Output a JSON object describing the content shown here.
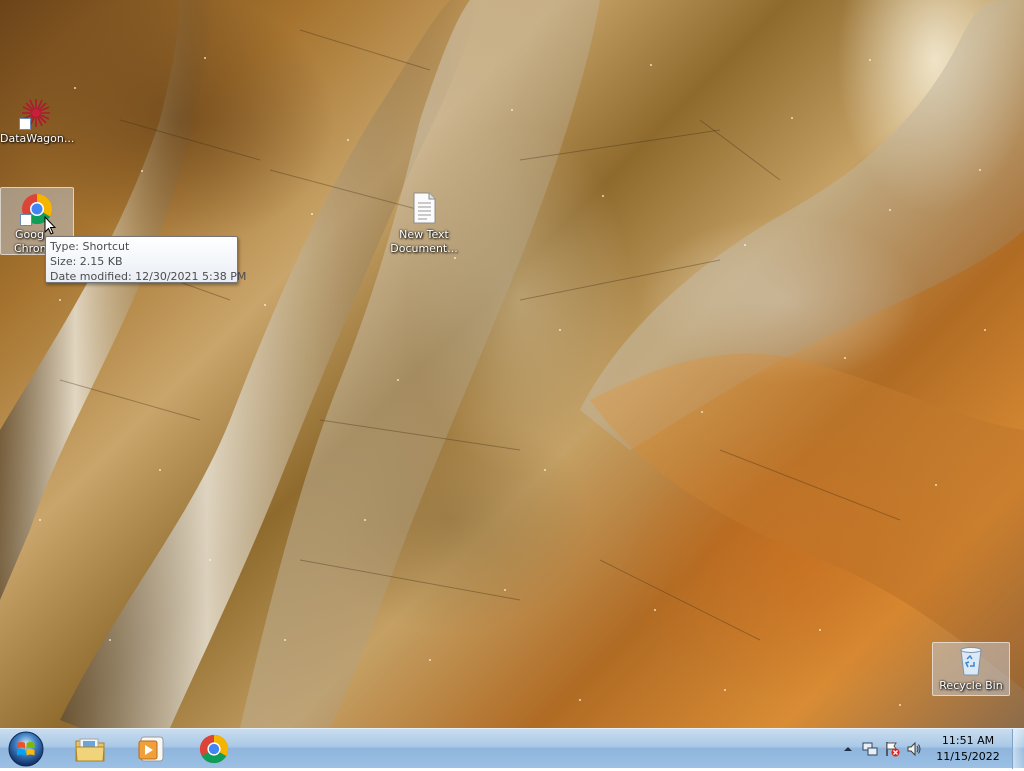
{
  "desktop": {
    "icons": [
      {
        "label": "DataWagon...",
        "icon": "datawagon-app-icon"
      },
      {
        "label": "Google Chrome",
        "label_visible": "Goog",
        "label_visible_2": "Chron",
        "icon": "chrome-icon"
      },
      {
        "label": "New Text Document...",
        "label_line1": "New Text",
        "label_line2": "Document...",
        "icon": "text-document-icon"
      },
      {
        "label": "Recycle Bin",
        "icon": "recycle-bin-icon"
      }
    ]
  },
  "tooltip": {
    "type": "Type: Shortcut",
    "size": "Size: 2.15 KB",
    "modified": "Date modified: 12/30/2021 5:38 PM"
  },
  "taskbar": {
    "start": {
      "icon": "windows-start-orb-icon"
    },
    "pinned": [
      {
        "name": "Windows Explorer",
        "icon": "folder-libraries-icon"
      },
      {
        "name": "Windows Media Player",
        "icon": "media-player-icon"
      },
      {
        "name": "Google Chrome",
        "icon": "chrome-icon"
      }
    ],
    "tray": {
      "icons": [
        "show-hidden-icons-chevron",
        "network-icon",
        "action-center-flag-icon",
        "volume-icon"
      ],
      "time": "11:51 AM",
      "date": "11/15/2022"
    }
  },
  "colors": {
    "taskbar_top": "#c9ddf0",
    "taskbar_bottom": "#9cc0e4",
    "selection": "#c8d7eb",
    "chrome_red": "#db4437",
    "chrome_yellow": "#f4b400",
    "chrome_green": "#0f9d58",
    "chrome_blue": "#4285f4"
  }
}
